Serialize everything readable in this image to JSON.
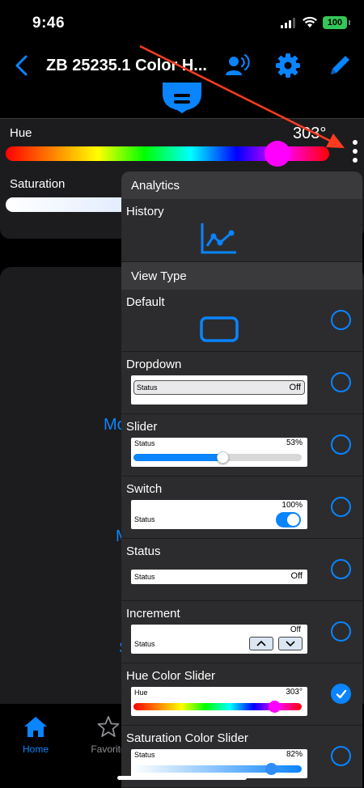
{
  "status_bar": {
    "time": "9:46",
    "battery": "100"
  },
  "nav": {
    "title": "ZB 25235.1 Color H..."
  },
  "controls": {
    "hue_label": "Hue",
    "hue_value": "303°",
    "hue_fraction": 0.84,
    "saturation_label": "Saturation"
  },
  "background": {
    "text_1": "Mo",
    "text_2": "M",
    "text_3": "S"
  },
  "tabbar": {
    "home_label": "Home",
    "favorites_label": "Favorite"
  },
  "popup": {
    "analytics_header": "Analytics",
    "history_label": "History",
    "view_type_header": "View Type",
    "options": [
      {
        "title": "Default",
        "selected": false
      },
      {
        "title": "Dropdown",
        "preview_label": "Status",
        "preview_value": "Off",
        "selected": false
      },
      {
        "title": "Slider",
        "preview_label": "Status",
        "preview_value": "53%",
        "fraction": 0.53,
        "selected": false
      },
      {
        "title": "Switch",
        "preview_label": "Status",
        "preview_value": "100%",
        "selected": false
      },
      {
        "title": "Status",
        "preview_label": "Status",
        "preview_value": "Off",
        "selected": false
      },
      {
        "title": "Increment",
        "preview_label": "Status",
        "preview_value": "Off",
        "selected": false
      },
      {
        "title": "Hue Color Slider",
        "preview_label": "Hue",
        "preview_value": "303°",
        "fraction": 0.84,
        "selected": true
      },
      {
        "title": "Saturation Color Slider",
        "preview_label": "Status",
        "preview_value": "82%",
        "fraction": 0.82,
        "selected": false
      }
    ]
  },
  "colors": {
    "accent": "#0a84ff",
    "hue_thumb": "#ff00ff",
    "annotation_arrow": "#ff3b1f",
    "battery": "#34c759"
  },
  "icons": {
    "nav": [
      "back-chevron-icon",
      "voice-control-icon",
      "gear-icon",
      "edit-pencil-icon"
    ],
    "tab": [
      "home-icon",
      "star-icon"
    ],
    "history": "line-chart-icon"
  }
}
